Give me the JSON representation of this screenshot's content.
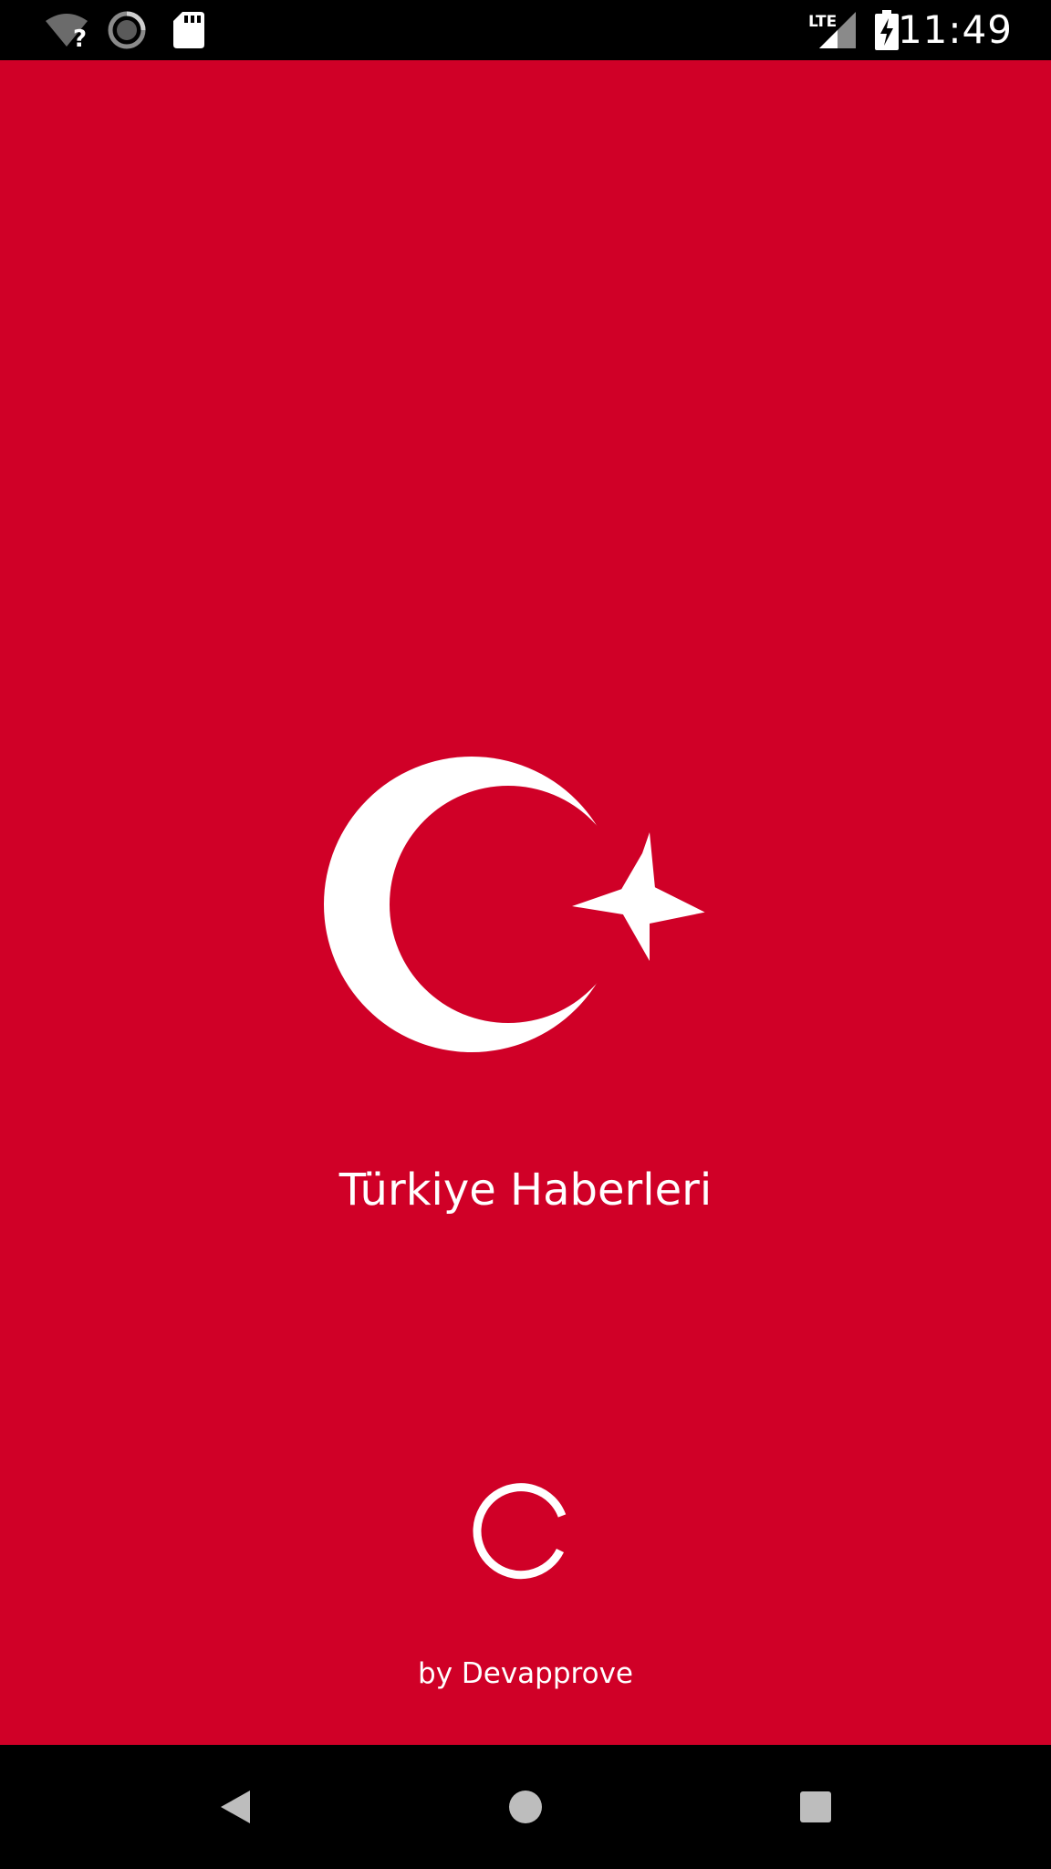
{
  "status_bar": {
    "time": "11:49",
    "network_type": "LTE",
    "icons": [
      "wifi-unknown-icon",
      "sync-progress-icon",
      "sd-card-icon",
      "lte-signal-icon",
      "battery-charging-icon"
    ]
  },
  "splash": {
    "title": "Türkiye Haberleri",
    "byline": "by Devapprove",
    "emblem": "crescent-star-icon",
    "loading": "loading-spinner-icon",
    "colors": {
      "background": "#d00027",
      "foreground": "#ffffff"
    }
  },
  "nav_bar": {
    "icons": [
      "back-icon",
      "home-icon",
      "recents-icon"
    ]
  }
}
